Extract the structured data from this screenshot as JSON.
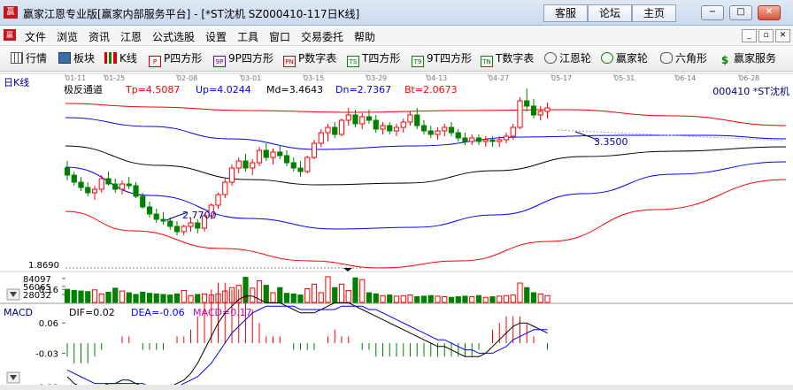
{
  "window": {
    "title": "赢家江恩专业版[赢家内部服务平台] - [*ST沈机  SZ000410-117日K线]",
    "buttons": [
      "客服",
      "论坛",
      "主页"
    ],
    "controls": [
      "−",
      "□",
      "✕"
    ]
  },
  "menubar": {
    "items": [
      "文件",
      "浏览",
      "资讯",
      "江恩",
      "公式选股",
      "设置",
      "工具",
      "窗口",
      "交易委托",
      "帮助"
    ],
    "controls": [
      "_",
      "▫",
      "✕"
    ]
  },
  "toolbar": {
    "items": [
      {
        "label": "行情",
        "icon": "grid-icon"
      },
      {
        "label": "板块",
        "icon": "sector-icon"
      },
      {
        "label": "K线",
        "icon": "candlestick-icon"
      },
      {
        "label": "P四方形",
        "icon": "P"
      },
      {
        "label": "9P四方形",
        "icon": "9P"
      },
      {
        "label": "P数字表",
        "icon": "PN"
      },
      {
        "label": "T四方形",
        "icon": "TS"
      },
      {
        "label": "9T四方形",
        "icon": "T9"
      },
      {
        "label": "T数字表",
        "icon": "TN"
      },
      {
        "label": "江恩轮",
        "icon": "wheel-icon"
      },
      {
        "label": "赢家轮",
        "icon": "wheel-icon"
      },
      {
        "label": "六角形",
        "icon": "hexagon-icon"
      },
      {
        "label": "赢家服务",
        "icon": "dollar-icon"
      }
    ]
  },
  "chart_panel": {
    "period_label": "日K线",
    "stock_label": "000410 *ST沈机",
    "dates": [
      "01-11",
      "01-25",
      "02-08",
      "03-01",
      "03-15",
      "03-29",
      "04-13",
      "04-27",
      "05-17",
      "05-31",
      "06-14",
      "06-28"
    ],
    "indicator": {
      "name": "极反通道",
      "items": [
        {
          "label": "Tp=4.5087",
          "color": "#ff0000"
        },
        {
          "label": "Up=4.0244",
          "color": "#0000ff"
        },
        {
          "label": "Md=3.4643",
          "color": "#000000"
        },
        {
          "label": "Dn=2.7367",
          "color": "#0000ff"
        },
        {
          "label": "Bt=2.0673",
          "color": "#ff0000"
        }
      ]
    },
    "annotations": {
      "high": "3.3500",
      "low": "2.7700",
      "bottom": "1.8690"
    }
  },
  "colors": {
    "up": "#ff0000",
    "down": "#008000",
    "band_outer": "#ff0000",
    "band_inner": "#0000ff",
    "mid": "#000000"
  },
  "chart_data": [
    {
      "type": "candlestick",
      "series_name": "*ST沈机",
      "ohlc": [
        [
          2.9,
          2.94,
          2.83,
          2.86
        ],
        [
          2.86,
          2.88,
          2.8,
          2.82
        ],
        [
          2.82,
          2.85,
          2.77,
          2.79
        ],
        [
          2.79,
          2.82,
          2.74,
          2.76
        ],
        [
          2.76,
          2.8,
          2.72,
          2.78
        ],
        [
          2.78,
          2.86,
          2.76,
          2.84
        ],
        [
          2.84,
          2.88,
          2.8,
          2.81
        ],
        [
          2.81,
          2.84,
          2.76,
          2.78
        ],
        [
          2.78,
          2.83,
          2.75,
          2.81
        ],
        [
          2.81,
          2.85,
          2.78,
          2.8
        ],
        [
          2.8,
          2.82,
          2.73,
          2.74
        ],
        [
          2.74,
          2.76,
          2.67,
          2.68
        ],
        [
          2.68,
          2.71,
          2.62,
          2.64
        ],
        [
          2.64,
          2.67,
          2.59,
          2.61
        ],
        [
          2.61,
          2.65,
          2.58,
          2.6
        ],
        [
          2.6,
          2.62,
          2.55,
          2.57
        ],
        [
          2.57,
          2.6,
          2.52,
          2.54
        ],
        [
          2.54,
          2.58,
          2.52,
          2.57
        ],
        [
          2.57,
          2.62,
          2.54,
          2.59
        ],
        [
          2.59,
          2.61,
          2.53,
          2.56
        ],
        [
          2.56,
          2.64,
          2.54,
          2.63
        ],
        [
          2.63,
          2.7,
          2.61,
          2.69
        ],
        [
          2.69,
          2.76,
          2.67,
          2.75
        ],
        [
          2.75,
          2.84,
          2.73,
          2.82
        ],
        [
          2.82,
          2.92,
          2.8,
          2.9
        ],
        [
          2.9,
          2.96,
          2.87,
          2.94
        ],
        [
          2.94,
          2.98,
          2.88,
          2.9
        ],
        [
          2.9,
          2.95,
          2.86,
          2.93
        ],
        [
          2.93,
          3.02,
          2.91,
          3.0
        ],
        [
          3.0,
          3.04,
          2.94,
          2.96
        ],
        [
          2.96,
          3.01,
          2.92,
          2.99
        ],
        [
          2.99,
          3.03,
          2.95,
          2.97
        ],
        [
          2.97,
          3.0,
          2.91,
          2.93
        ],
        [
          2.93,
          2.96,
          2.88,
          2.9
        ],
        [
          2.9,
          2.94,
          2.85,
          2.88
        ],
        [
          2.88,
          2.97,
          2.87,
          2.96
        ],
        [
          2.96,
          3.06,
          2.95,
          3.04
        ],
        [
          3.04,
          3.12,
          3.02,
          3.1
        ],
        [
          3.1,
          3.15,
          3.05,
          3.13
        ],
        [
          3.13,
          3.16,
          3.07,
          3.09
        ],
        [
          3.09,
          3.18,
          3.08,
          3.17
        ],
        [
          3.17,
          3.24,
          3.14,
          3.2
        ],
        [
          3.2,
          3.23,
          3.13,
          3.15
        ],
        [
          3.15,
          3.21,
          3.12,
          3.19
        ],
        [
          3.19,
          3.23,
          3.15,
          3.17
        ],
        [
          3.17,
          3.2,
          3.1,
          3.12
        ],
        [
          3.12,
          3.16,
          3.09,
          3.14
        ],
        [
          3.14,
          3.16,
          3.09,
          3.11
        ],
        [
          3.11,
          3.15,
          3.08,
          3.13
        ],
        [
          3.13,
          3.18,
          3.1,
          3.16
        ],
        [
          3.16,
          3.22,
          3.14,
          3.2
        ],
        [
          3.2,
          3.24,
          3.12,
          3.14
        ],
        [
          3.14,
          3.17,
          3.09,
          3.11
        ],
        [
          3.11,
          3.14,
          3.07,
          3.09
        ],
        [
          3.09,
          3.13,
          3.06,
          3.11
        ],
        [
          3.11,
          3.15,
          3.08,
          3.13
        ],
        [
          3.13,
          3.16,
          3.08,
          3.1
        ],
        [
          3.1,
          3.12,
          3.05,
          3.07
        ],
        [
          3.07,
          3.1,
          3.03,
          3.05
        ],
        [
          3.05,
          3.09,
          3.03,
          3.07
        ],
        [
          3.07,
          3.09,
          3.03,
          3.05
        ],
        [
          3.05,
          3.08,
          3.02,
          3.06
        ],
        [
          3.06,
          3.08,
          3.02,
          3.05
        ],
        [
          3.05,
          3.08,
          3.02,
          3.06
        ],
        [
          3.06,
          3.1,
          3.04,
          3.08
        ],
        [
          3.08,
          3.15,
          3.06,
          3.13
        ],
        [
          3.13,
          3.3,
          3.12,
          3.28
        ],
        [
          3.28,
          3.35,
          3.22,
          3.25
        ],
        [
          3.25,
          3.29,
          3.18,
          3.2
        ],
        [
          3.2,
          3.25,
          3.17,
          3.22
        ],
        [
          3.22,
          3.27,
          3.18,
          3.24
        ]
      ]
    },
    {
      "type": "bar",
      "series_name": "成交量",
      "y_ticks": [
        "84097",
        "56065",
        "28032"
      ],
      "values": [
        46000,
        42000,
        40000,
        38000,
        44000,
        30000,
        36000,
        50000,
        40000,
        34000,
        28000,
        36000,
        32000,
        30000,
        28000,
        26000,
        30000,
        42000,
        24000,
        28000,
        30000,
        26000,
        30000,
        40000,
        52000,
        60000,
        88000,
        50000,
        76000,
        60000,
        34000,
        52000,
        32000,
        30000,
        26000,
        48000,
        64000,
        34000,
        90000,
        52000,
        64000,
        42000,
        86000,
        80000,
        34000,
        30000,
        24000,
        26000,
        22000,
        24000,
        26000,
        20000,
        22000,
        24000,
        22000,
        20000,
        18000,
        20000,
        22000,
        20000,
        24000,
        18000,
        20000,
        22000,
        24000,
        26000,
        68000,
        52000,
        34000,
        30000,
        24000
      ]
    },
    {
      "type": "line",
      "series_name": "MACD",
      "labels": [
        {
          "label": "DIF=0.02",
          "color": "#000000"
        },
        {
          "label": "DEA=-0.06",
          "color": "#0000ff"
        },
        {
          "label": "MACD=0.17",
          "color": "#c000c0"
        }
      ],
      "y_ticks": [
        "0.16",
        "0.06",
        "-0.03",
        "-0.13"
      ],
      "dif": [
        -0.1,
        -0.12,
        -0.13,
        -0.14,
        -0.14,
        -0.13,
        -0.12,
        -0.12,
        -0.11,
        -0.11,
        -0.12,
        -0.13,
        -0.14,
        -0.14,
        -0.14,
        -0.13,
        -0.12,
        -0.11,
        -0.09,
        -0.06,
        -0.02,
        0.02,
        0.06,
        0.09,
        0.11,
        0.13,
        0.14,
        0.14,
        0.13,
        0.12,
        0.12,
        0.12,
        0.11,
        0.1,
        0.09,
        0.09,
        0.09,
        0.1,
        0.11,
        0.12,
        0.12,
        0.12,
        0.11,
        0.1,
        0.09,
        0.08,
        0.07,
        0.06,
        0.05,
        0.04,
        0.03,
        0.02,
        0.01,
        0.0,
        -0.01,
        -0.01,
        -0.02,
        -0.03,
        -0.04,
        -0.04,
        -0.04,
        -0.03,
        -0.01,
        0.01,
        0.03,
        0.05,
        0.06,
        0.06,
        0.05,
        0.04,
        0.03
      ],
      "dea": [
        -0.08,
        -0.09,
        -0.1,
        -0.11,
        -0.12,
        -0.12,
        -0.12,
        -0.12,
        -0.12,
        -0.12,
        -0.12,
        -0.12,
        -0.13,
        -0.13,
        -0.13,
        -0.13,
        -0.13,
        -0.12,
        -0.11,
        -0.1,
        -0.08,
        -0.06,
        -0.03,
        0.0,
        0.03,
        0.05,
        0.07,
        0.09,
        0.1,
        0.11,
        0.11,
        0.11,
        0.11,
        0.11,
        0.1,
        0.1,
        0.1,
        0.1,
        0.1,
        0.1,
        0.11,
        0.11,
        0.11,
        0.11,
        0.1,
        0.1,
        0.09,
        0.08,
        0.07,
        0.06,
        0.05,
        0.04,
        0.03,
        0.02,
        0.01,
        0.01,
        0.0,
        -0.01,
        -0.02,
        -0.02,
        -0.03,
        -0.03,
        -0.03,
        -0.02,
        -0.01,
        0.01,
        0.02,
        0.03,
        0.04,
        0.04,
        0.04
      ]
    }
  ]
}
